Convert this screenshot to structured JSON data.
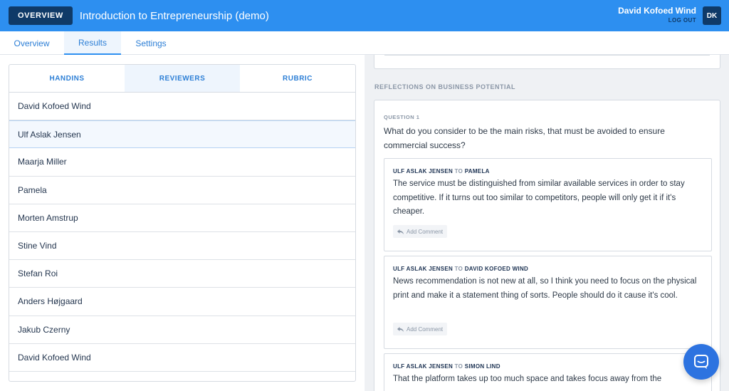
{
  "header": {
    "overview_label": "OVERVIEW",
    "course_title": "Introduction to Entrepreneurship (demo)",
    "user_name": "David Kofoed Wind",
    "logout_label": "LOG OUT",
    "avatar_initials": "DK"
  },
  "nav": {
    "tabs": [
      {
        "label": "Overview"
      },
      {
        "label": "Results"
      },
      {
        "label": "Settings"
      }
    ],
    "active": "Results"
  },
  "left": {
    "subtabs": [
      {
        "label": "HANDINS"
      },
      {
        "label": "REVIEWERS"
      },
      {
        "label": "RUBRIC"
      }
    ],
    "active_subtab": "REVIEWERS",
    "people": [
      "David Kofoed Wind",
      "Ulf Aslak Jensen",
      "Maarja Miller",
      "Pamela",
      "Morten Amstrup",
      "Stine Vind",
      "Stefan Roi",
      "Anders Højgaard",
      "Jakub Czerny",
      "David Kofoed Wind"
    ],
    "selected": "Ulf Aslak Jensen"
  },
  "right": {
    "section_title": "REFLECTIONS ON BUSINESS POTENTIAL",
    "question_label": "QUESTION 1",
    "question_text": "What do you consider to be the main risks, that must be avoided to ensure commercial success?",
    "answers": [
      {
        "from": "ULF ASLAK JENSEN",
        "to_word": "TO",
        "to": "PAMELA",
        "text": "The service must be distinguished from similar available services in order to stay competitive. If it turns out too similar to competitors, people will only get it if it's cheaper.",
        "add_comment": "Add Comment"
      },
      {
        "from": "ULF ASLAK JENSEN",
        "to_word": "TO",
        "to": "DAVID KOFOED WIND",
        "text": "News recommendation is not new at all, so I think you need to focus on the physical print and make it a statement thing of sorts. People should do it cause it's cool.",
        "add_comment": "Add Comment"
      },
      {
        "from": "ULF ASLAK JENSEN",
        "to_word": "TO",
        "to": "SIMON LIND",
        "text": "That the platform takes up too much space and takes focus away from the"
      }
    ]
  },
  "colors": {
    "topbar": "#2d8ff0",
    "dark_navy": "#0f3a68",
    "link_blue": "#2d7fd6",
    "chat_bubble": "#2d73e0"
  },
  "icons": {
    "reply": "reply-arrow-icon",
    "chat": "chat-icon"
  }
}
